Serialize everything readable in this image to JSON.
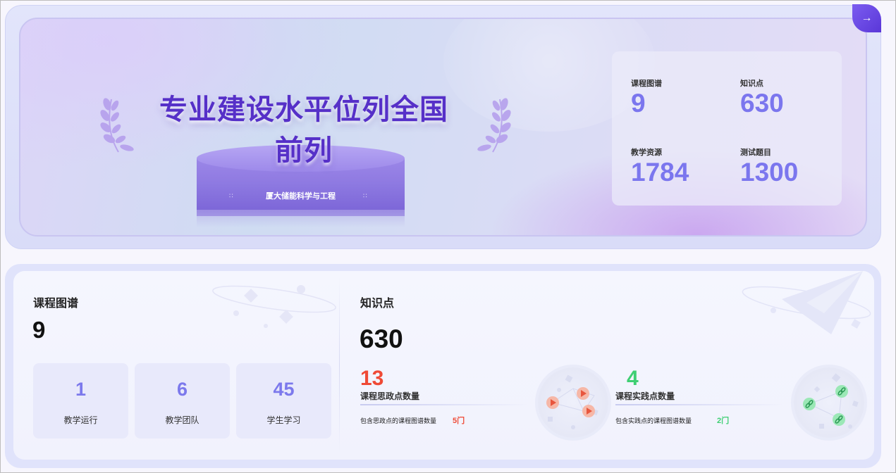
{
  "hero": {
    "headline": "专业建设水平位列全国前列",
    "podium_label": "厦大储能科学与工程",
    "arrow_glyph": "→",
    "stats": [
      {
        "label": "课程图谱",
        "value": "9"
      },
      {
        "label": "知识点",
        "value": "630"
      },
      {
        "label": "教学资源",
        "value": "1784"
      },
      {
        "label": "测试题目",
        "value": "1300"
      }
    ]
  },
  "course_map": {
    "title": "课程图谱",
    "value": "9",
    "cards": [
      {
        "value": "1",
        "label": "教学运行"
      },
      {
        "value": "6",
        "label": "教学团队"
      },
      {
        "value": "45",
        "label": "学生学习"
      }
    ]
  },
  "knowledge": {
    "title": "知识点",
    "value": "630",
    "ideology": {
      "count": "13",
      "title": "课程思政点数量",
      "note": "包含思政点的课程图谱数量",
      "note_value": "5门",
      "color": "#ef4a36"
    },
    "practice": {
      "count": "4",
      "title": "课程实践点数量",
      "note": "包含实践点的课程图谱数量",
      "note_value": "2门",
      "color": "#3fcf73"
    }
  },
  "colors": {
    "accent": "#5630c8",
    "stat_value": "#7b76ee",
    "mini_value": "#7c79ec"
  }
}
